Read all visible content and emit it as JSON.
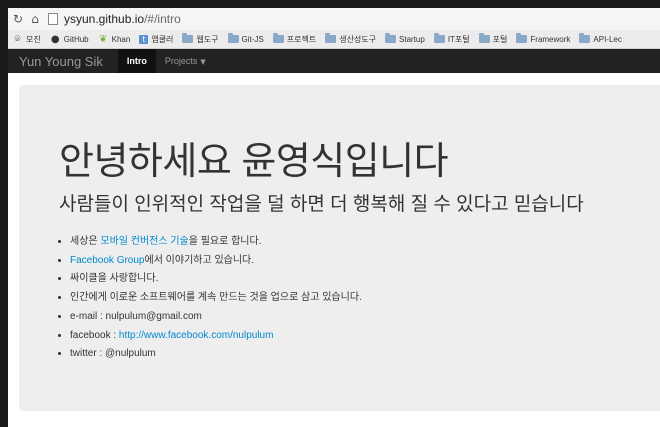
{
  "browser": {
    "url_host": "ysyun.github.io",
    "url_path": "/#/intro"
  },
  "bookmarks": [
    {
      "label": "모진",
      "icon": "globe-icon",
      "kind": "site"
    },
    {
      "label": "GitHub",
      "icon": "github-icon",
      "kind": "site"
    },
    {
      "label": "Khan",
      "icon": "leaf-icon",
      "kind": "site"
    },
    {
      "label": "앱쿨러",
      "icon": "t-icon",
      "kind": "site"
    },
    {
      "label": "웹도구",
      "icon": "folder-icon",
      "kind": "folder"
    },
    {
      "label": "Git-JS",
      "icon": "folder-icon",
      "kind": "folder"
    },
    {
      "label": "프로젝트",
      "icon": "folder-icon",
      "kind": "folder"
    },
    {
      "label": "생산성도구",
      "icon": "folder-icon",
      "kind": "folder"
    },
    {
      "label": "Startup",
      "icon": "folder-icon",
      "kind": "folder"
    },
    {
      "label": "IT포털",
      "icon": "folder-icon",
      "kind": "folder"
    },
    {
      "label": "포털",
      "icon": "folder-icon",
      "kind": "folder"
    },
    {
      "label": "Framework",
      "icon": "folder-icon",
      "kind": "folder"
    },
    {
      "label": "API-Lec",
      "icon": "folder-icon",
      "kind": "folder"
    }
  ],
  "navbar": {
    "brand": "Yun Young Sik",
    "items": [
      {
        "label": "Intro",
        "active": true
      },
      {
        "label": "Projects",
        "dropdown": true
      }
    ]
  },
  "hero": {
    "title": "안녕하세요 윤영식입니다",
    "subtitle": "사람들이 인위적인 작업을 덜 하면 더 행복해 질 수 있다고 믿습니다",
    "items": [
      {
        "pre": "세상은 ",
        "link": "모바일 컨버전스 기술",
        "post": "을 필요로 합니다."
      },
      {
        "pre": "",
        "link": "Facebook Group",
        "post": "에서 이야기하고 있습니다."
      },
      {
        "pre": "싸이클을 사랑합니다.",
        "link": "",
        "post": ""
      },
      {
        "pre": "인간에게 이로운 소프트웨어를 계속 만드는 것을 업으로 삼고 있습니다.",
        "link": "",
        "post": ""
      },
      {
        "pre": "e-mail : nulpulum@gmail.com",
        "link": "",
        "post": ""
      },
      {
        "pre": "facebook : ",
        "link": "http://www.facebook.com/nulpulum",
        "post": ""
      },
      {
        "pre": "twitter : @nulpulum",
        "link": "",
        "post": ""
      }
    ]
  },
  "colors": {
    "navbar_bg": "#222222",
    "hero_bg": "#eeeeee",
    "link": "#0088cc"
  }
}
